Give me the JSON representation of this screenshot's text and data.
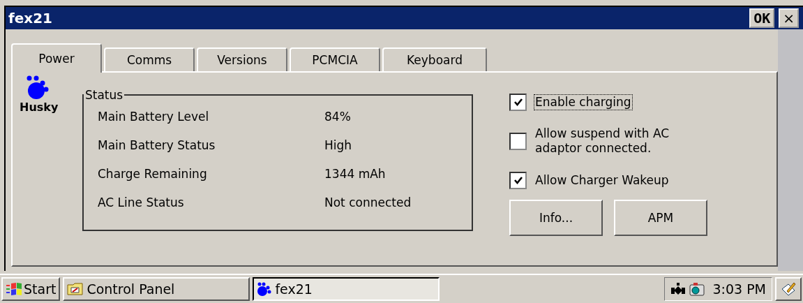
{
  "window": {
    "title": "fex21",
    "ok_button": "OK",
    "close_button": "×"
  },
  "tabs": [
    {
      "label": "Power",
      "selected": true
    },
    {
      "label": "Comms",
      "selected": false
    },
    {
      "label": "Versions",
      "selected": false
    },
    {
      "label": "PCMCIA",
      "selected": false
    },
    {
      "label": "Keyboard",
      "selected": false
    }
  ],
  "logo": {
    "text": "Husky"
  },
  "status": {
    "title": "Status",
    "rows": [
      {
        "label": "Main Battery Level",
        "value": "84%"
      },
      {
        "label": "Main Battery Status",
        "value": "High"
      },
      {
        "label": "Charge Remaining",
        "value": "1344 mAh"
      },
      {
        "label": "AC Line Status",
        "value": "Not connected"
      }
    ]
  },
  "options": [
    {
      "label": "Enable charging",
      "checked": true,
      "focused": true
    },
    {
      "label": "Allow suspend with AC adaptor connected.",
      "checked": false,
      "focused": false
    },
    {
      "label": "Allow Charger Wakeup",
      "checked": true,
      "focused": false
    }
  ],
  "buttons": [
    "Info...",
    "APM"
  ],
  "taskbar": {
    "start": "Start",
    "items": [
      {
        "label": "Control Panel",
        "kind": "folder",
        "selected": false
      },
      {
        "label": "fex21",
        "kind": "paw",
        "selected": true
      }
    ],
    "clock": "3:03 PM"
  }
}
